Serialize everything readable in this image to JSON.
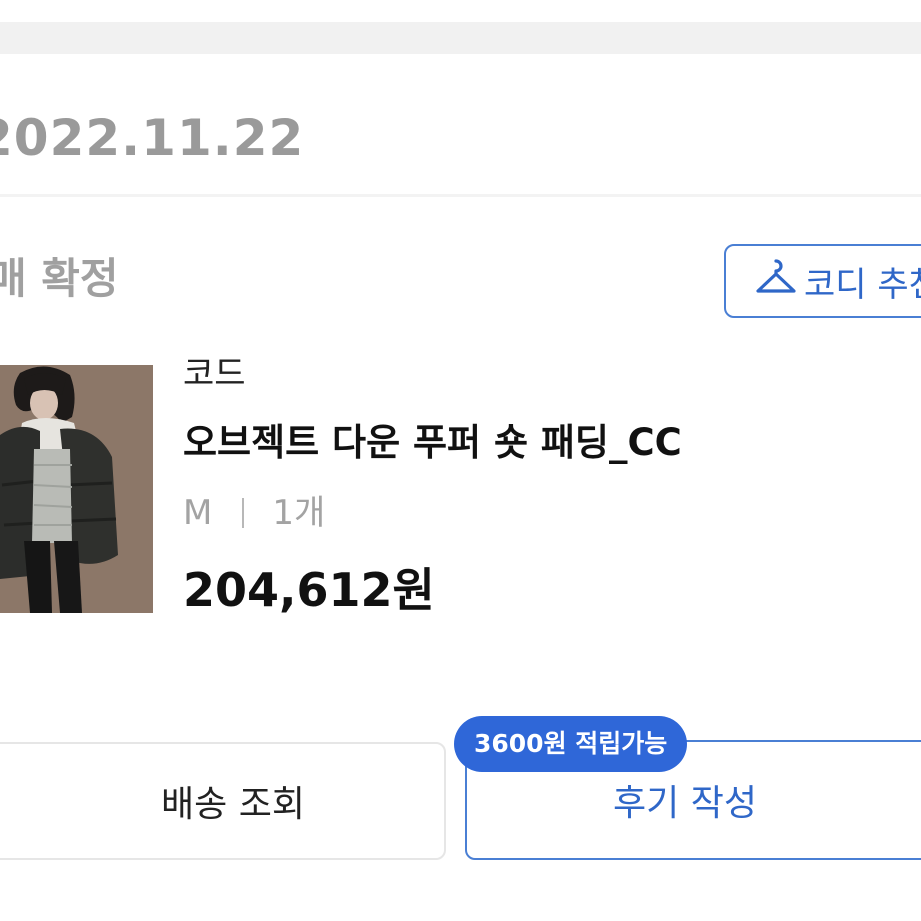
{
  "order": {
    "date": "2022.11.22",
    "status": "매 확정"
  },
  "coordi_button": {
    "label": "코디 추천",
    "icon": "hanger-icon"
  },
  "product": {
    "brand": "코드",
    "name": "오브젝트 다운 푸퍼 숏 패딩_CC",
    "option_size": "M",
    "option_qty": "1개",
    "price": "204,612원"
  },
  "actions": {
    "tracking_label": "배송 조회",
    "review_label": "후기 작성",
    "points_badge": "3600원 적립가능"
  },
  "colors": {
    "accent": "#2f67c8",
    "badge": "#2f67d8",
    "muted_text": "#9a9a9a"
  }
}
